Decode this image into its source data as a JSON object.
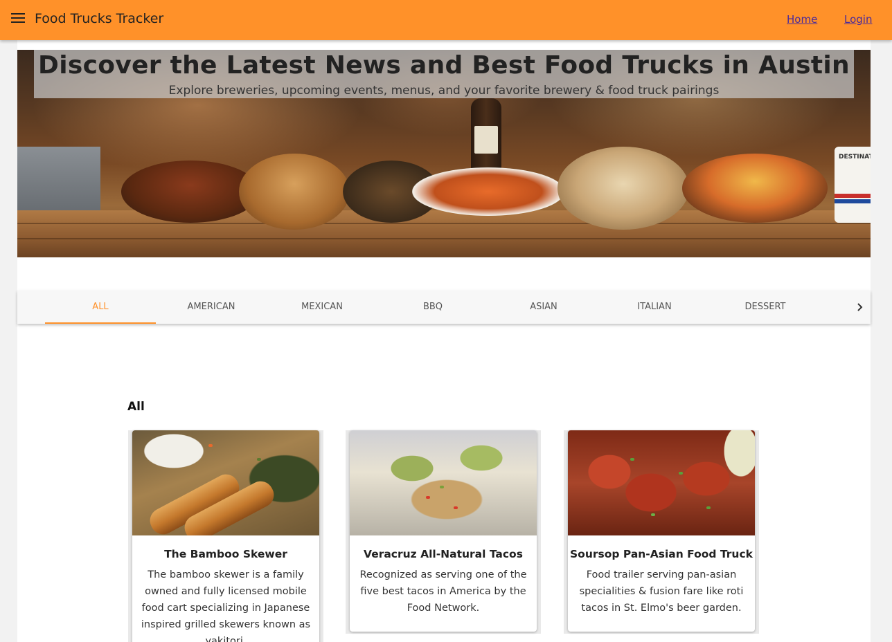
{
  "appbar": {
    "title": "Food Trucks Tracker",
    "nav": [
      {
        "label": "Home"
      },
      {
        "label": "Login"
      }
    ]
  },
  "hero": {
    "title": "Discover the Latest News and Best Food Trucks in Austin",
    "subtitle": "Explore breweries, upcoming events, menus, and your favorite brewery & food truck pairings",
    "mug_text": "DESTINATI"
  },
  "tabs": {
    "items": [
      {
        "label": "All",
        "active": true
      },
      {
        "label": "American"
      },
      {
        "label": "Mexican"
      },
      {
        "label": "BBQ"
      },
      {
        "label": "Asian"
      },
      {
        "label": "Italian"
      },
      {
        "label": "Dessert"
      }
    ]
  },
  "section": {
    "title": "All"
  },
  "cards": [
    {
      "title": "The Bamboo Skewer",
      "description": "The bamboo skewer is a family owned and fully licensed mobile food cart specializing in Japanese inspired grilled skewers known as yakitori."
    },
    {
      "title": "Veracruz All-Natural Tacos",
      "description": "Recognized as serving one of the five best tacos in America by the Food Network."
    },
    {
      "title": "Soursop Pan-Asian Food Truck",
      "description": "Food trailer serving pan-asian specialities & fusion fare like roti tacos in St. Elmo's beer garden."
    }
  ],
  "colors": {
    "appbar": "#ff9129",
    "accent": "#ff9129",
    "link": "#4a2a9a"
  }
}
